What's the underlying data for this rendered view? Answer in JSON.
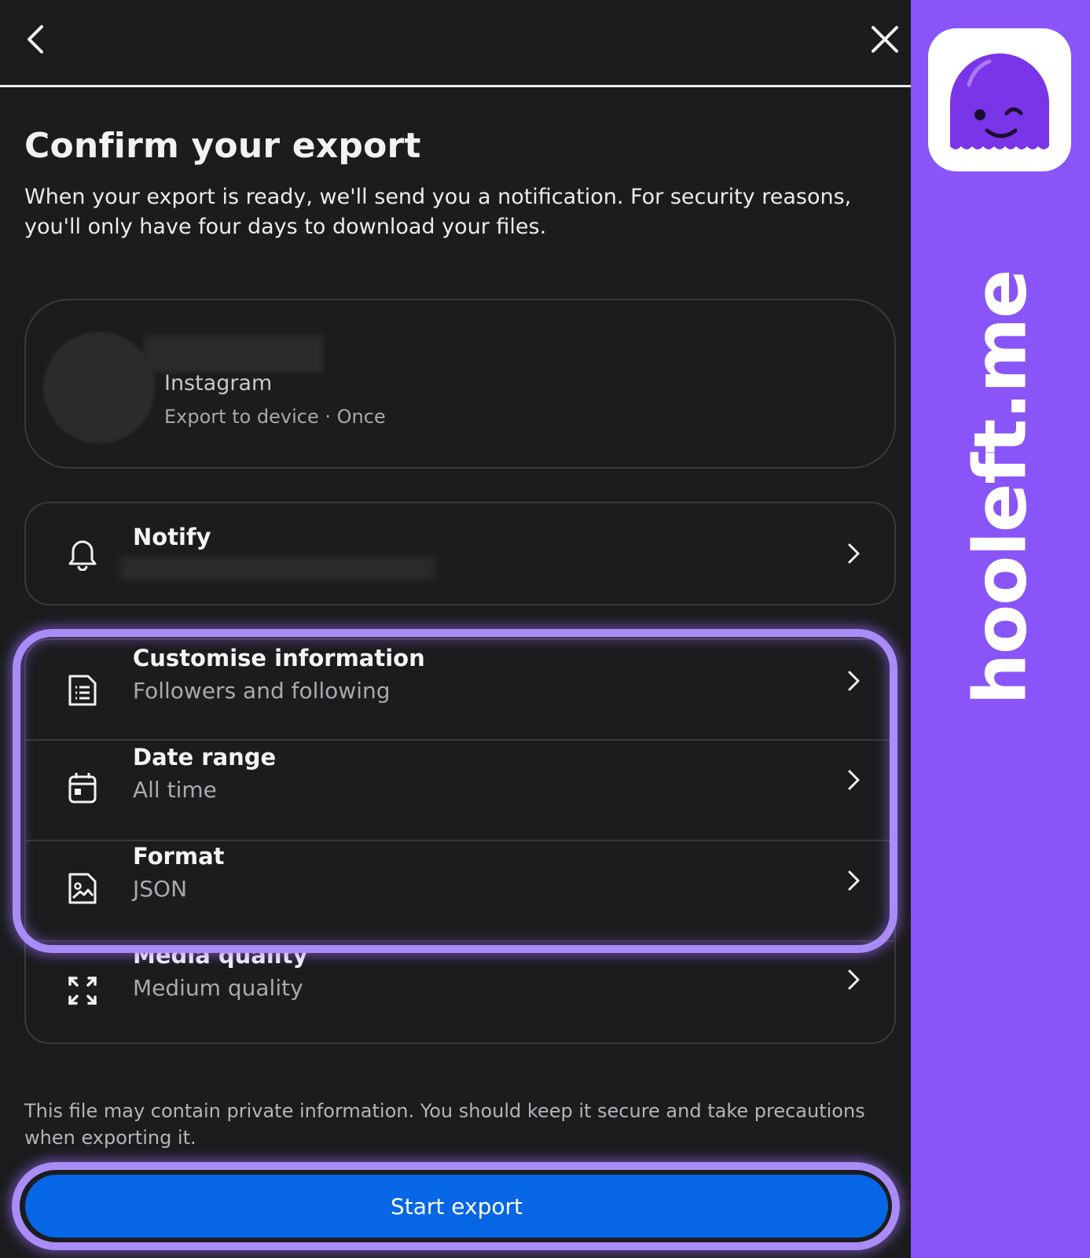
{
  "header": {
    "back_icon": "chevron-left-icon",
    "close_icon": "close-icon"
  },
  "page": {
    "title": "Confirm your export",
    "description": "When your export is ready, we'll send you a notification. For security reasons, you'll only have four days to download your files."
  },
  "account": {
    "app": "Instagram",
    "destination": "Export to device · Once"
  },
  "notify": {
    "label": "Notify",
    "icon": "bell-icon"
  },
  "options": [
    {
      "label": "Customise information",
      "value": "Followers and following",
      "icon": "document-list-icon"
    },
    {
      "label": "Date range",
      "value": "All time",
      "icon": "calendar-icon"
    },
    {
      "label": "Format",
      "value": "JSON",
      "icon": "image-file-icon"
    },
    {
      "label": "Media quality",
      "value": "Medium quality",
      "icon": "expand-arrows-icon"
    }
  ],
  "disclaimer": "This file may contain private information. You should keep it secure and take precautions when exporting it.",
  "start_button": "Start export",
  "brand": {
    "text": "hooleft.me",
    "background": "#8a55f8",
    "highlight": "#a98cf7",
    "button_color": "#0766e6"
  }
}
